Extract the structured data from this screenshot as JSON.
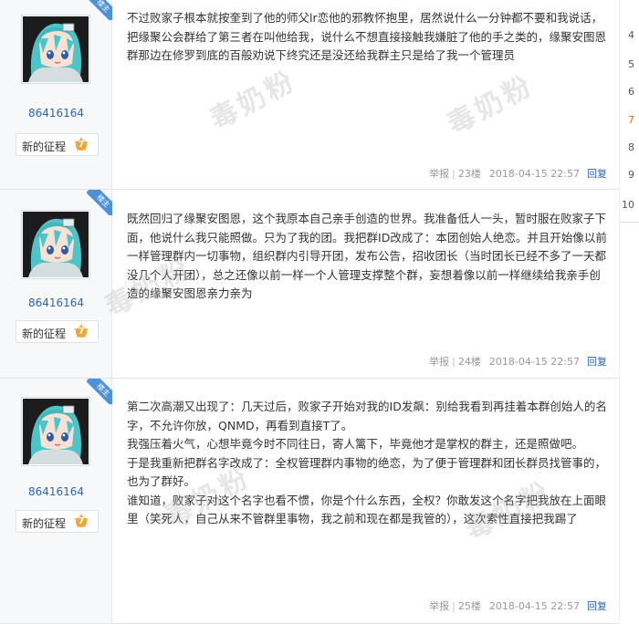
{
  "posts": [
    {
      "username": "86416164",
      "role_badge": "楼主",
      "badge_name": "新的征程",
      "badge_level": "7",
      "text": "不过败家子根本就按奎到了他的师父lr恋他的邪教怀抱里，居然说什么一分钟都不要和我说话，把缘聚公会群给了第三者在叫他给我，说什么不想直接接触我嫌脏了他的手之类的，缘聚安图恩群那边在修罗到底的百般劝说下终究还是没还给我群主只是给了我一个管理员",
      "report": "举报",
      "floor": "23楼",
      "time": "2018-04-15 22:57",
      "reply": "回复"
    },
    {
      "username": "86416164",
      "role_badge": "楼主",
      "badge_name": "新的征程",
      "badge_level": "7",
      "text": "既然回归了缘聚安图恩，这个我原本自己亲手创造的世界。我准备低人一头，暂时服在败家子下面，他说什么我只能照做。只为了我的团。我把群ID改成了：本团创始人绝恋。并且开始像以前一样管理群内一切事物，组织群内引导开团，发布公告，招收团长（当时团长已经不多了一天都没几个人开团），总之还像以前一样一个人管理支撑整个群，妄想着像以前一样继续给我亲手创造的缘聚安图恩亲力亲为",
      "report": "举报",
      "floor": "24楼",
      "time": "2018-04-15 22:57",
      "reply": "回复"
    },
    {
      "username": "86416164",
      "role_badge": "楼主",
      "badge_name": "新的征程",
      "badge_level": "7",
      "paragraphs": [
        "第二次高潮又出现了：几天过后，败家子开始对我的ID发飙：别给我看到再挂着本群创始人的名字，不允许你放，QNMD，再看到直接T了。",
        "我强压着火气，心想毕竟今时不同往日，寄人篱下，毕竟他才是掌权的群主，还是照做吧。",
        "于是我重新把群名字改成了：全权管理群内事物的绝恋，为了便于管理群和团长群员找管事的，也为了群好。",
        "谁知道，败家子对这个名字也看不惯，你是个什么东西，全权？你敢发这个名字把我放在上面眼里（笑死人，自己从来不管群里事物，我之前和现在都是我管的），这次索性直接把我踢了"
      ],
      "report": "举报",
      "floor": "25楼",
      "time": "2018-04-15 22:57",
      "reply": "回复"
    }
  ],
  "watermark_text": "毒奶粉",
  "right_strip_numbers": [
    "4",
    "5",
    "6",
    "7",
    "8",
    "9",
    "10"
  ],
  "colors": {
    "link_blue": "#2d64b3",
    "badge_orange": "#f0a53a",
    "ribbon_blue": "#4d92d9"
  }
}
